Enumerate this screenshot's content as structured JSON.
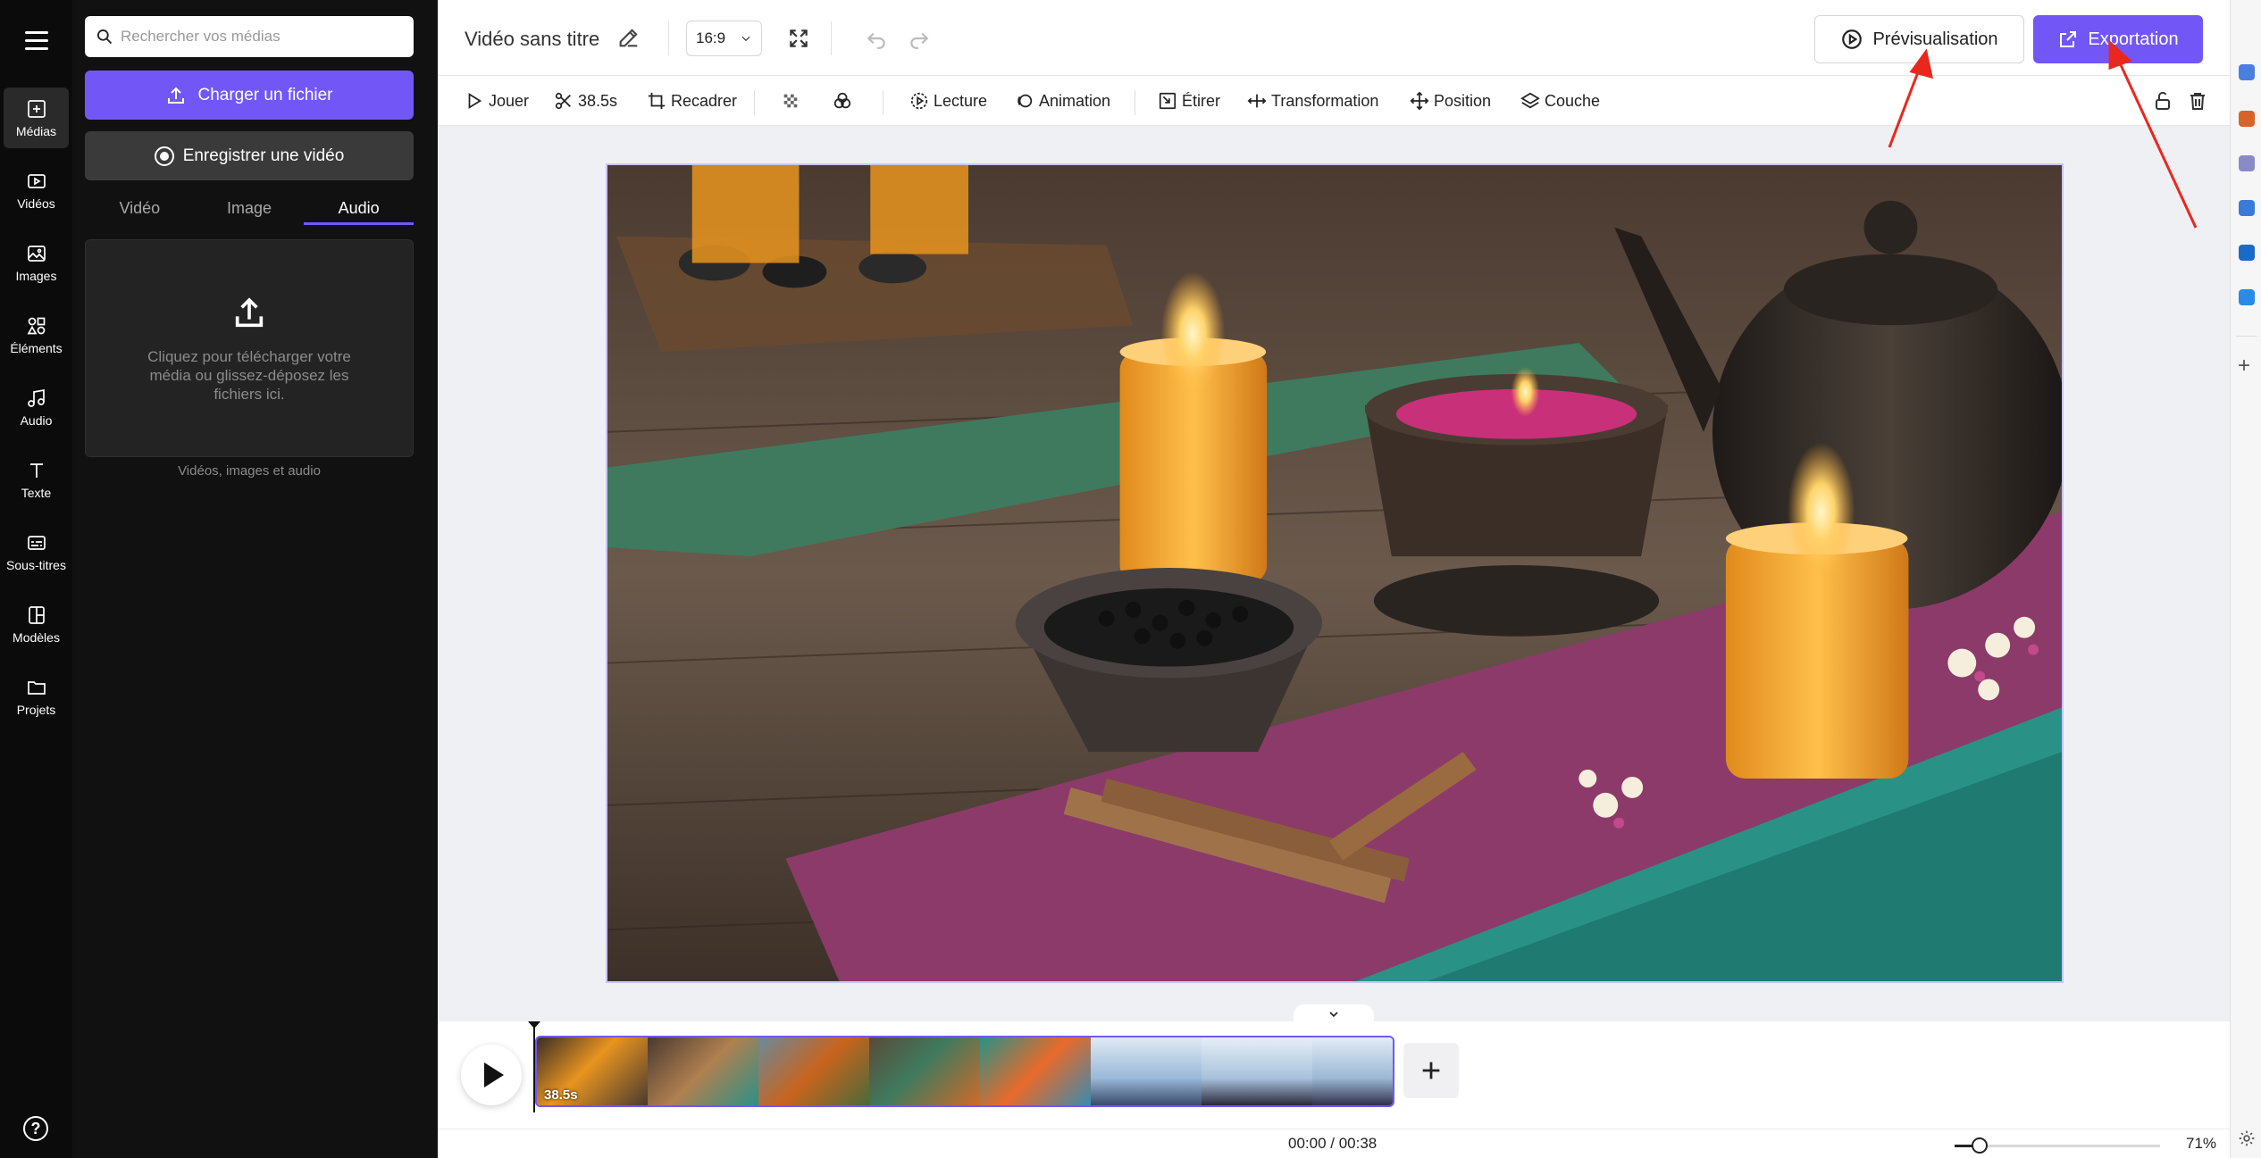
{
  "sidebar": {
    "items": [
      {
        "label": "Médias",
        "icon": "media-add-icon"
      },
      {
        "label": "Vidéos",
        "icon": "video-icon"
      },
      {
        "label": "Images",
        "icon": "image-icon"
      },
      {
        "label": "Éléments",
        "icon": "elements-icon"
      },
      {
        "label": "Audio",
        "icon": "music-note-icon"
      },
      {
        "label": "Texte",
        "icon": "text-icon"
      },
      {
        "label": "Sous-titres",
        "icon": "subtitles-icon"
      },
      {
        "label": "Modèles",
        "icon": "templates-icon"
      },
      {
        "label": "Projets",
        "icon": "folder-icon"
      }
    ],
    "active": "Médias"
  },
  "media_panel": {
    "search_placeholder": "Rechercher vos médias",
    "upload_label": "Charger un fichier",
    "record_label": "Enregistrer une vidéo",
    "tabs": [
      "Vidéo",
      "Image",
      "Audio"
    ],
    "active_tab": "Audio",
    "dropzone_text": "Cliquez pour télécharger votre média ou glissez-déposez les fichiers ici.",
    "dropzone_caption": "Vidéos, images et audio"
  },
  "header": {
    "title": "Vidéo sans titre",
    "aspect_ratio": "16:9",
    "preview_label": "Prévisualisation",
    "export_label": "Exportation"
  },
  "toolbar": {
    "play_label": "Jouer",
    "duration_label": "38.5s",
    "crop_label": "Recadrer",
    "playback_label": "Lecture",
    "animation_label": "Animation",
    "stretch_label": "Étirer",
    "transform_label": "Transformation",
    "position_label": "Position",
    "layer_label": "Couche"
  },
  "timeline": {
    "clip_duration": "38.5s",
    "current_time": "00:00",
    "total_time": "00:38",
    "time_display": "00:00 / 00:38",
    "zoom_value": "71%",
    "zoom_fraction": 0.12
  },
  "colors": {
    "accent": "#7357f6",
    "sidebar_bg": "#0b0b0b",
    "panel_bg": "#111111",
    "annotation": "#e8281e"
  }
}
